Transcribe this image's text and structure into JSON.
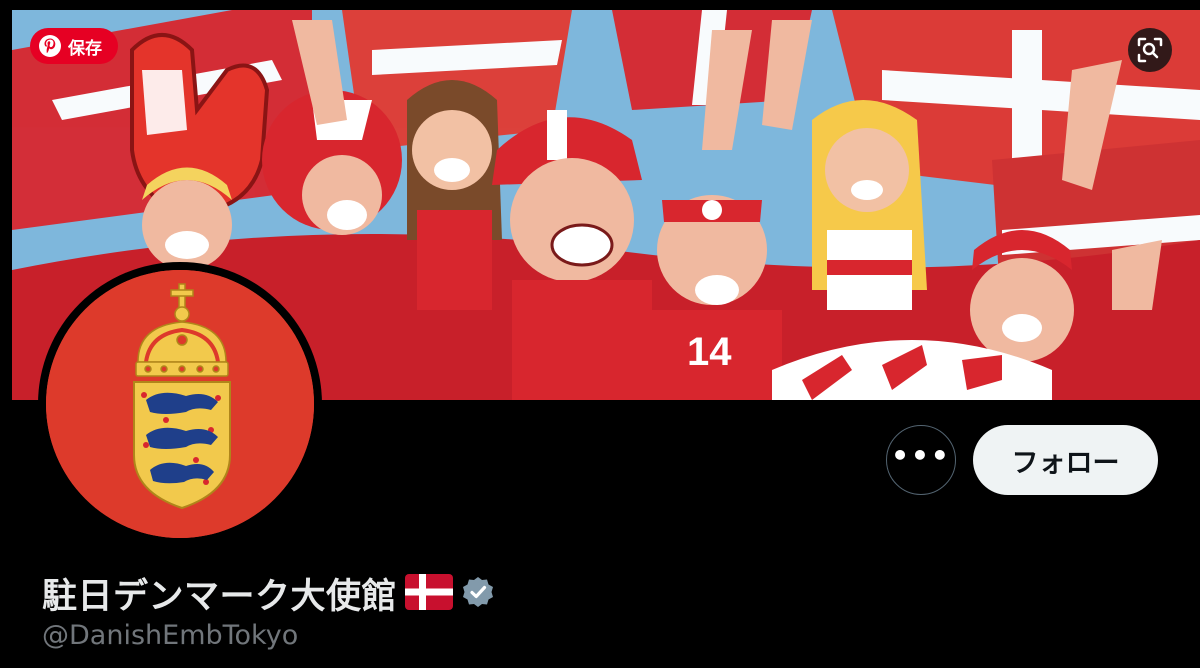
{
  "pinterest": {
    "save_label": "保存"
  },
  "profile": {
    "display_name": "駐日デンマーク大使館",
    "handle": "@DanishEmbTokyo",
    "verified": true
  },
  "actions": {
    "more_label": "•••",
    "follow_label": "フォロー"
  },
  "colors": {
    "avatar_bg": "#dd3a2b",
    "follow_bg": "#eff3f4",
    "pinterest_red": "#e60023",
    "denmark_red": "#c8102e",
    "sky": "#7eb7dc"
  },
  "icons": {
    "pin": "pinterest-logo-icon",
    "lens": "visual-search-icon",
    "flag": "denmark-flag-icon",
    "badge": "verified-badge-icon"
  }
}
